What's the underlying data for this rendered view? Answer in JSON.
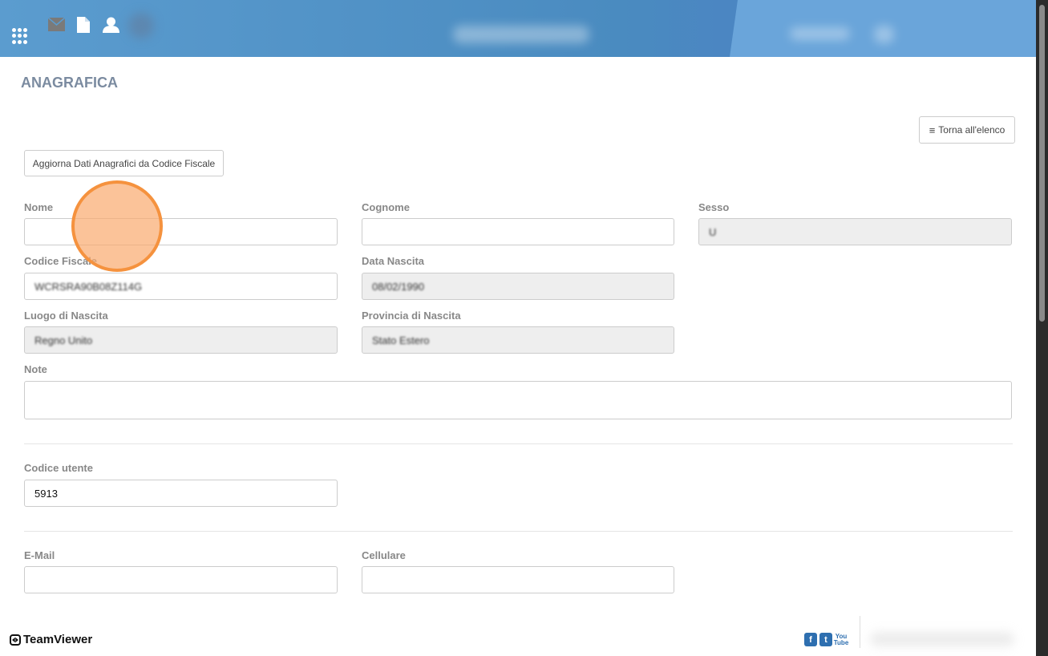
{
  "header": {
    "icons": [
      "apps-grid-icon",
      "mail-icon",
      "document-icon",
      "user-icon"
    ]
  },
  "page": {
    "title": "ANAGRAFICA",
    "back_label": "Torna all'elenco",
    "update_label": "Aggiorna Dati Anagrafici da Codice Fiscale"
  },
  "form": {
    "nome": {
      "label": "Nome",
      "value": ""
    },
    "cognome": {
      "label": "Cognome",
      "value": ""
    },
    "sesso": {
      "label": "Sesso",
      "value": "U"
    },
    "codice_fiscale": {
      "label": "Codice Fiscale",
      "value": "WCRSRA90B08Z114G"
    },
    "data_nascita": {
      "label": "Data Nascita",
      "value": "08/02/1990"
    },
    "luogo_nascita": {
      "label": "Luogo di Nascita",
      "value": "Regno Unito"
    },
    "provincia_nascita": {
      "label": "Provincia di Nascita",
      "value": "Stato Estero"
    },
    "note": {
      "label": "Note",
      "value": ""
    },
    "codice_utente": {
      "label": "Codice utente",
      "value": "5913"
    },
    "email": {
      "label": "E-Mail",
      "value": ""
    },
    "cellulare": {
      "label": "Cellulare",
      "value": ""
    }
  },
  "footer": {
    "teamviewer": "TeamViewer",
    "social": [
      "facebook-icon",
      "twitter-icon",
      "youtube-icon"
    ],
    "youtube_text": "You Tube"
  },
  "colors": {
    "header": "#4a8bc0",
    "accent_circle": "#f5923e",
    "social": "#2e6fb0"
  }
}
